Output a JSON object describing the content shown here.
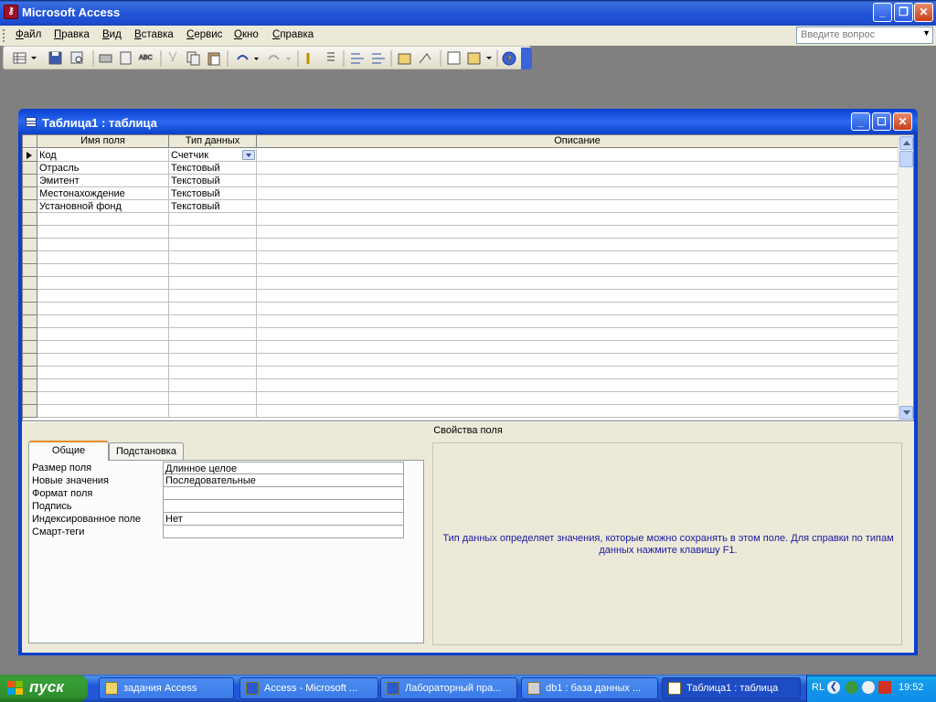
{
  "app": {
    "title": "Microsoft Access"
  },
  "menu": [
    {
      "label": "Файл",
      "u": "Ф",
      "rest": "айл"
    },
    {
      "label": "Правка",
      "u": "П",
      "rest": "равка"
    },
    {
      "label": "Вид",
      "u": "В",
      "rest": "ид"
    },
    {
      "label": "Вставка",
      "u": "В",
      "rest": "ставка"
    },
    {
      "label": "Сервис",
      "u": "С",
      "rest": "ервис"
    },
    {
      "label": "Окно",
      "u": "О",
      "rest": "кно"
    },
    {
      "label": "Справка",
      "u": "С",
      "rest": "правка"
    }
  ],
  "help_placeholder": "Введите вопрос",
  "child": {
    "title": "Таблица1 : таблица"
  },
  "grid": {
    "headers": [
      "Имя поля",
      "Тип данных",
      "Описание"
    ],
    "rows": [
      {
        "name": "Код",
        "type": "Счетчик",
        "desc": ""
      },
      {
        "name": "Отрасль",
        "type": "Текстовый",
        "desc": ""
      },
      {
        "name": "Эмитент",
        "type": "Текстовый",
        "desc": ""
      },
      {
        "name": "Местонахождение",
        "type": "Текстовый",
        "desc": ""
      },
      {
        "name": "Установной фонд",
        "type": "Текстовый",
        "desc": ""
      }
    ]
  },
  "props": {
    "title": "Свойства поля",
    "tabs": [
      "Общие",
      "Подстановка"
    ],
    "rows": [
      {
        "label": "Размер поля",
        "value": "Длинное целое"
      },
      {
        "label": "Новые значения",
        "value": "Последовательные"
      },
      {
        "label": "Формат поля",
        "value": ""
      },
      {
        "label": "Подпись",
        "value": ""
      },
      {
        "label": "Индексированное поле",
        "value": "Нет"
      },
      {
        "label": "Смарт-теги",
        "value": ""
      }
    ],
    "hint_line1": "Тип данных определяет значения, которые можно сохранять в этом поле.  Для справки по типам",
    "hint_line2": "данных нажмите клавишу F1."
  },
  "taskbar": {
    "start": "пуск",
    "tasks": [
      {
        "label": "задания Access"
      },
      {
        "label": "Access - Microsoft ..."
      },
      {
        "label": "Лабораторный пра..."
      },
      {
        "label": "db1 : база данных ..."
      },
      {
        "label": "Таблица1 : таблица"
      }
    ],
    "lang": "RL",
    "clock": "19:52"
  }
}
